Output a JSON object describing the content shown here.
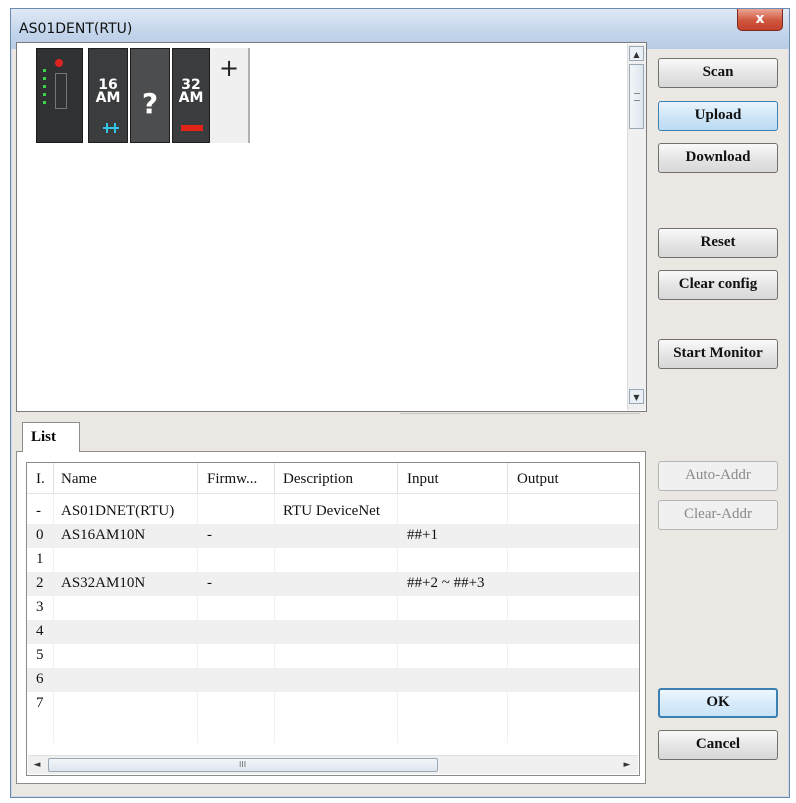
{
  "window": {
    "title": "AS01DENT(RTU)",
    "close_glyph": "x"
  },
  "rack": {
    "modules": [
      {
        "type": "cpu"
      },
      {
        "type": "io",
        "label": "16\nAM"
      },
      {
        "type": "empty",
        "label": "?"
      },
      {
        "type": "io",
        "label": "32\nAM"
      },
      {
        "type": "add",
        "label": "+"
      }
    ]
  },
  "buttons": {
    "scan": "Scan",
    "upload": "Upload",
    "download": "Download",
    "reset": "Reset",
    "clear_config": "Clear config",
    "start_monitor": "Start Monitor",
    "auto_addr": "Auto-Addr",
    "clear_addr": "Clear-Addr",
    "ok": "OK",
    "cancel": "Cancel"
  },
  "list": {
    "tab_label": "List",
    "columns": [
      "I.",
      "Name",
      "Firmw...",
      "Description",
      "Input",
      "Output"
    ],
    "rows": [
      [
        "-",
        "AS01DNET(RTU)",
        "",
        "RTU DeviceNet",
        "",
        ""
      ],
      [
        "0",
        "AS16AM10N",
        "-",
        "",
        "##+1",
        ""
      ],
      [
        "1",
        "",
        "",
        "",
        "",
        ""
      ],
      [
        "2",
        "AS32AM10N",
        "-",
        "",
        "##+2 ~ ##+3",
        ""
      ],
      [
        "3",
        "",
        "",
        "",
        "",
        ""
      ],
      [
        "4",
        "",
        "",
        "",
        "",
        ""
      ],
      [
        "5",
        "",
        "",
        "",
        "",
        ""
      ],
      [
        "6",
        "",
        "",
        "",
        "",
        ""
      ],
      [
        "7",
        "",
        "",
        "",
        "",
        ""
      ]
    ],
    "scroll_grip": "III"
  },
  "colors": {
    "accent_blue": "#3c7fb1",
    "close_red": "#c2402a",
    "led_green": "#3dd44c",
    "bar_red": "#e2231a"
  }
}
